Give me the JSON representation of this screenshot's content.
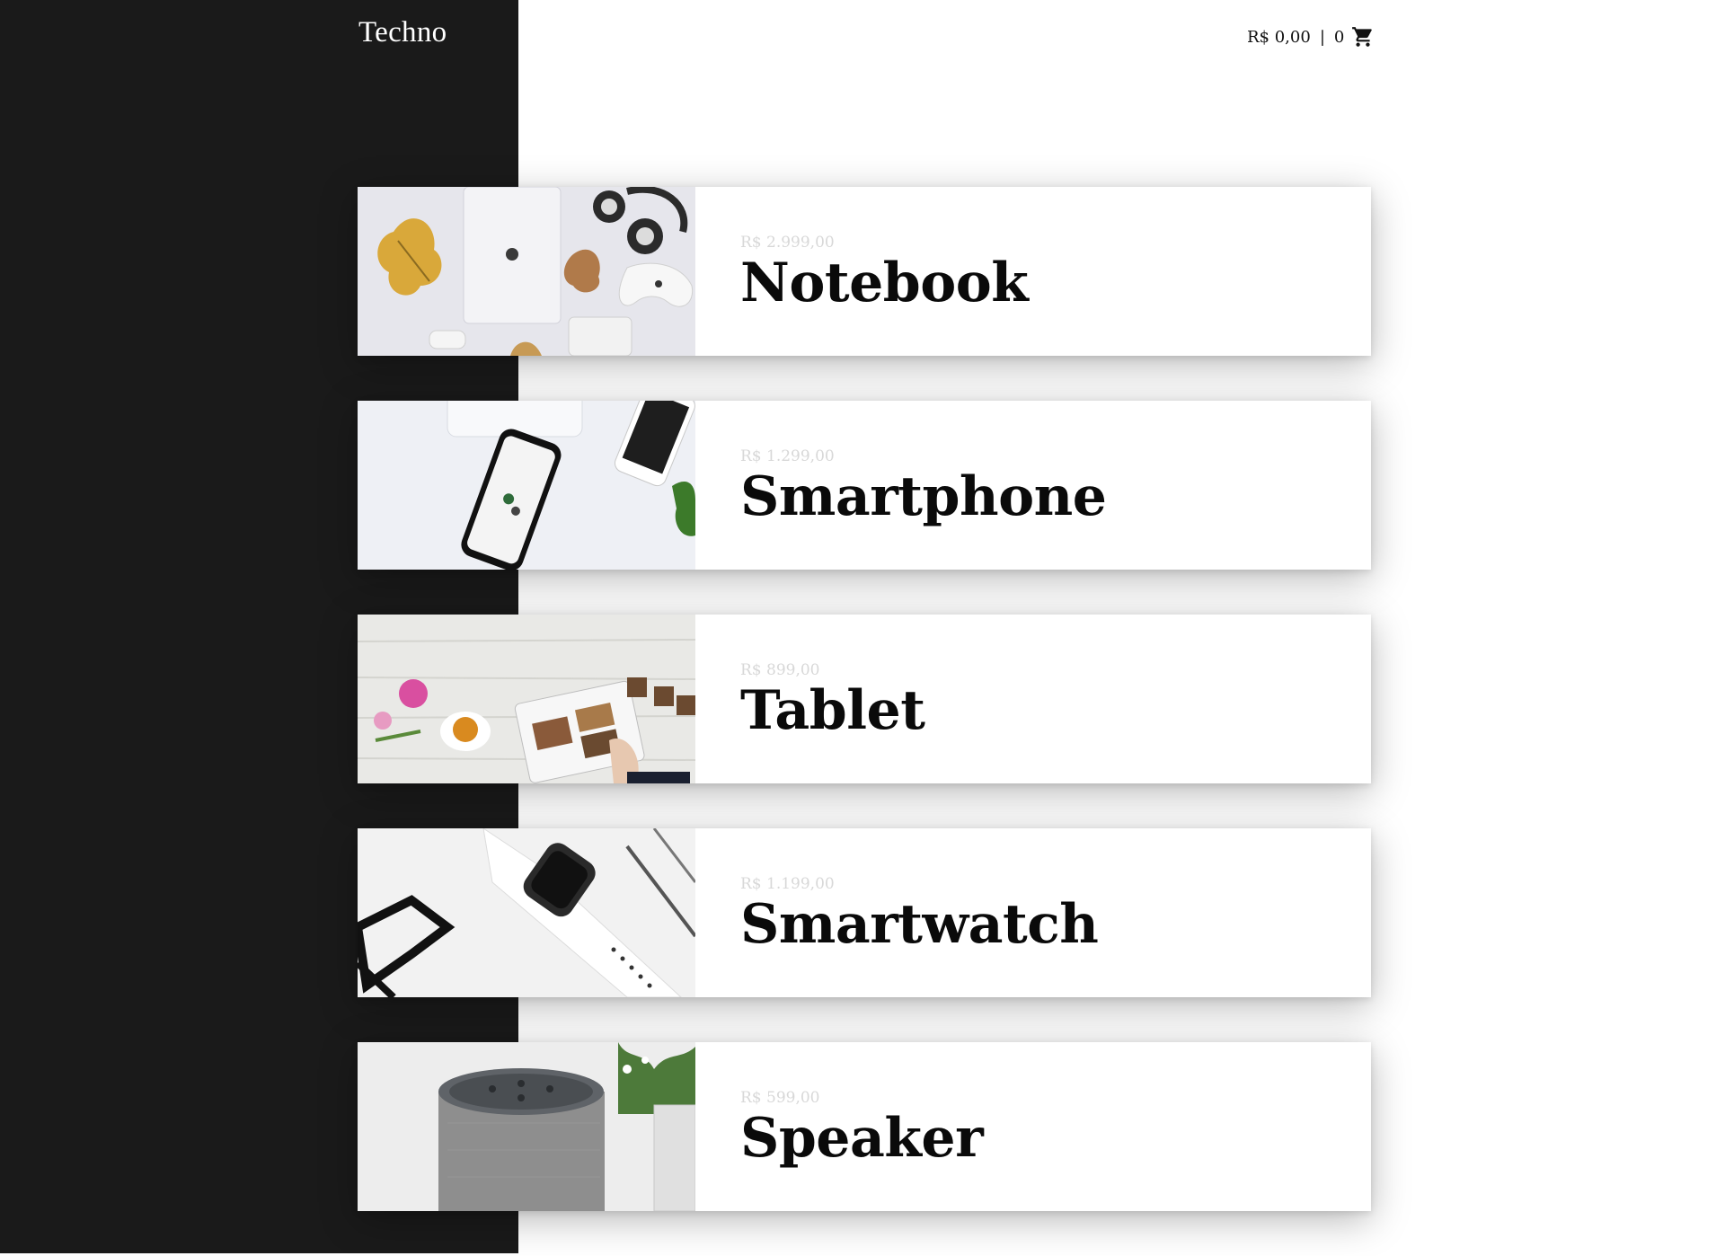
{
  "header": {
    "brand": "Techno",
    "cart_total": "R$ 0,00",
    "cart_separator": "|",
    "cart_count": "0",
    "cart_icon": "cart-icon"
  },
  "products": [
    {
      "price": "R$ 2.999,00",
      "name": "Notebook",
      "image": "notebook-photo"
    },
    {
      "price": "R$ 1.299,00",
      "name": "Smartphone",
      "image": "smartphone-photo"
    },
    {
      "price": "R$ 899,00",
      "name": "Tablet",
      "image": "tablet-photo"
    },
    {
      "price": "R$ 1.199,00",
      "name": "Smartwatch",
      "image": "smartwatch-photo"
    },
    {
      "price": "R$ 599,00",
      "name": "Speaker",
      "image": "speaker-photo"
    }
  ],
  "colors": {
    "sidebar": "#1a1a1a",
    "background": "#ffffff",
    "price_text": "#d8d8d8",
    "title_text": "#0a0a0a"
  }
}
